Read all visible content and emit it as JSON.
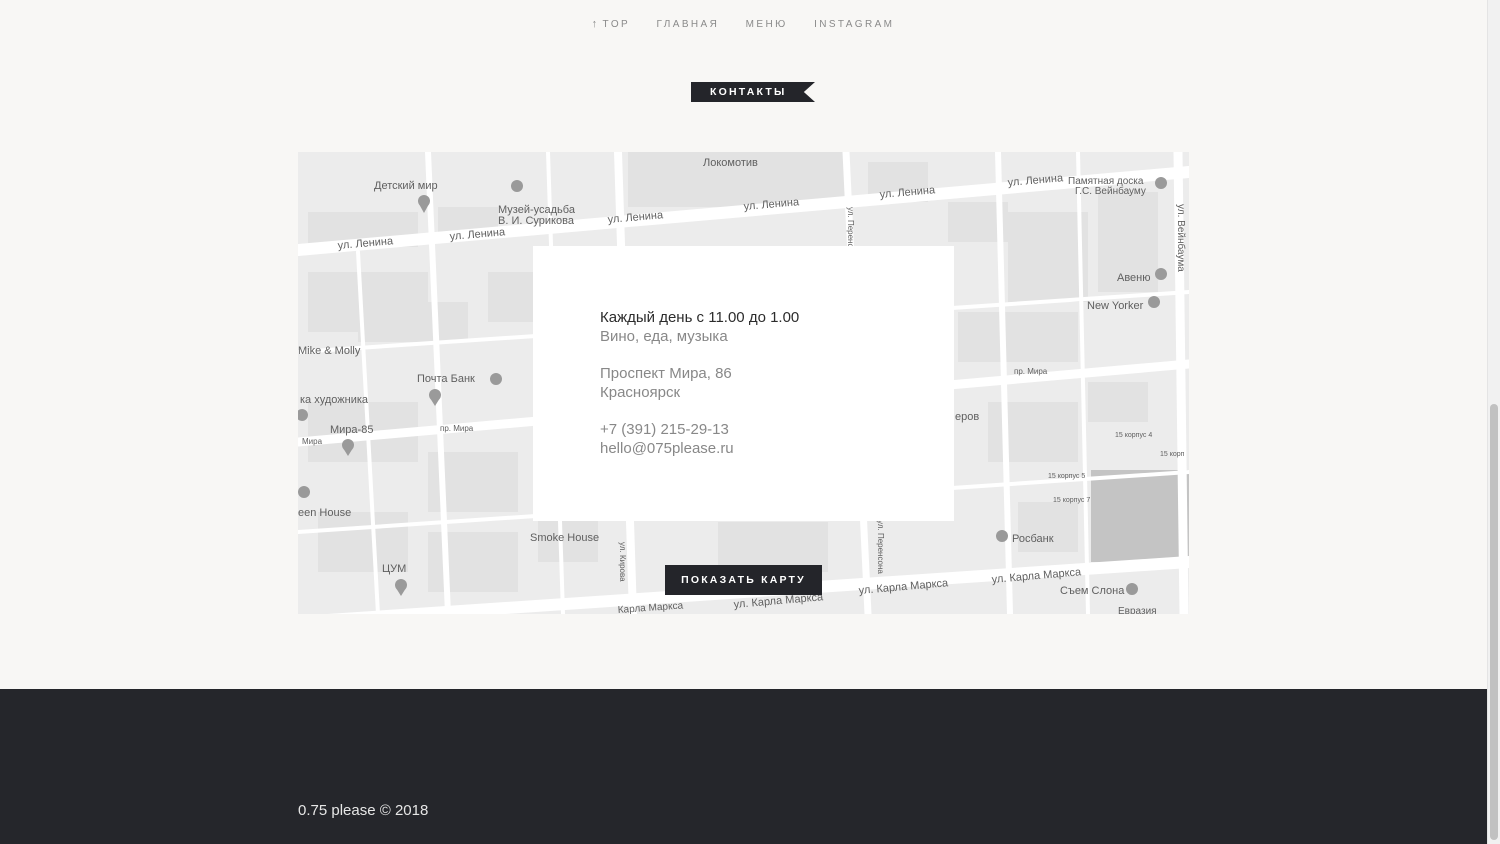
{
  "nav": {
    "items": [
      {
        "label": "TOP",
        "icon": "arrow-up-icon"
      },
      {
        "label": "ГЛАВНАЯ"
      },
      {
        "label": "МЕНЮ"
      },
      {
        "label": "INSTAGRAM"
      }
    ]
  },
  "section": {
    "label": "КОНТАКТЫ"
  },
  "map": {
    "labels": {
      "lokomotiv": "Локомотив",
      "detsky_mir": "Детский мир",
      "muzei1": "Музей-усадьба",
      "muzei2": "В. И. Сурикова",
      "lenina1": "ул. Ленина",
      "lenina2": "ул. Ленина",
      "lenina3": "ул. Ленина",
      "lenina4": "ул. Ленина",
      "lenina5": "ул. Ленина",
      "lenina6": "ул. Ленина",
      "pamyatnaya1": "Памятная доска",
      "pamyatnaya2": "Г.С. Вейнбауму",
      "veinbauma": "ул. Вейнбаума",
      "avenue": "Авеню",
      "newyorker": "New Yorker",
      "mike": "Mike & Molly",
      "pochta": "Почта Банк",
      "lavka": "ка художника",
      "mira85": "Мира-85",
      "mira_pr1": "пр. Мира",
      "mira_pr2": "пр. Мира",
      "mira_pr3": "Мира",
      "green": "een House",
      "smoke": "Smoke House",
      "tsum": "ЦУМ",
      "rosbank": "Росбанк",
      "marksa1": "ул. Карла Маркса",
      "marksa2": "ул. Карла Маркса",
      "marksa3": "ул. Карла Маркса",
      "marksa4": "Карла Маркса",
      "sloni": "Съем Слона",
      "kirova": "ул. Кирова",
      "perensona1": "ул. Перенсона",
      "perensona2": "ул. Перенс",
      "eroy": "еров",
      "korpus4": "15 корпус 4",
      "korpus5": "15 корпус 5",
      "korpus7": "15 корпус 7",
      "korp": "15 корп",
      "evrazia": "Евразия"
    }
  },
  "info": {
    "hours": "Каждый день с 11.00 до 1.00",
    "tagline": "Вино, еда, музыка",
    "address1": "Проспект Мира, 86",
    "address2": "Красноярск",
    "phone": "+7 (391) 215-29-13",
    "email": "hello@075please.ru"
  },
  "button": {
    "show_map": "ПОКАЗАТЬ КАРТУ"
  },
  "footer": {
    "copyright": "0.75 please © 2018"
  }
}
